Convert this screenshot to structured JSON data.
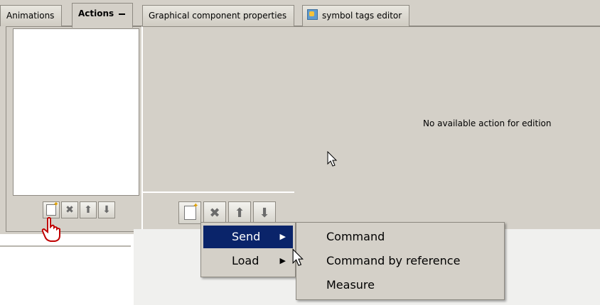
{
  "tabs": [
    {
      "label": "Animations"
    },
    {
      "label": "Actions"
    },
    {
      "label": "Graphical component properties"
    },
    {
      "label": "symbol tags editor"
    }
  ],
  "main": {
    "empty_message": "No available action for edition"
  },
  "menu": {
    "items": [
      {
        "label": "Send",
        "arrow": "▶"
      },
      {
        "label": "Load",
        "arrow": "▶"
      }
    ],
    "submenu": [
      {
        "label": "Command"
      },
      {
        "label": "Command by reference"
      },
      {
        "label": "Measure"
      }
    ]
  },
  "icons": {
    "new": "new-icon",
    "delete": "delete-icon",
    "up": "arrow-up-icon",
    "down": "arrow-down-icon"
  },
  "colors": {
    "panel": "#d4d0c8",
    "selection": "#0a246a"
  }
}
